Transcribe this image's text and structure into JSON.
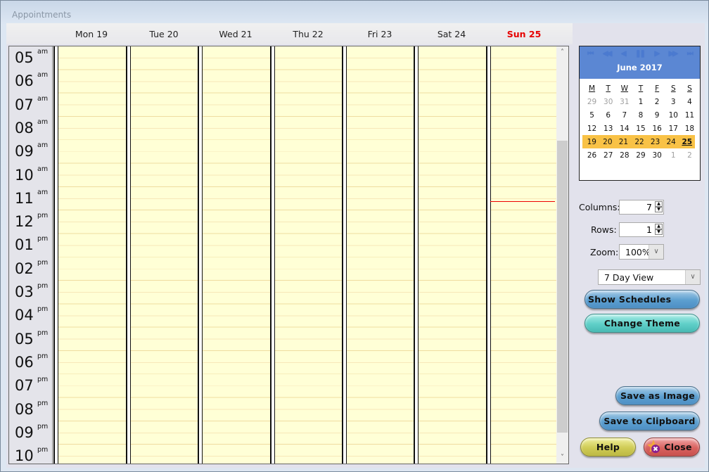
{
  "window": {
    "title": "Appointments"
  },
  "days": [
    {
      "label": "Mon 19",
      "today": false
    },
    {
      "label": "Tue 20",
      "today": false
    },
    {
      "label": "Wed 21",
      "today": false
    },
    {
      "label": "Thu 22",
      "today": false
    },
    {
      "label": "Fri 23",
      "today": false
    },
    {
      "label": "Sat 24",
      "today": false
    },
    {
      "label": "Sun 25",
      "today": true
    }
  ],
  "hours": [
    {
      "hr": "05",
      "ap": "am"
    },
    {
      "hr": "06",
      "ap": "am"
    },
    {
      "hr": "07",
      "ap": "am"
    },
    {
      "hr": "08",
      "ap": "am"
    },
    {
      "hr": "09",
      "ap": "am"
    },
    {
      "hr": "10",
      "ap": "am"
    },
    {
      "hr": "11",
      "ap": "am"
    },
    {
      "hr": "12",
      "ap": "pm"
    },
    {
      "hr": "01",
      "ap": "pm"
    },
    {
      "hr": "02",
      "ap": "pm"
    },
    {
      "hr": "03",
      "ap": "pm"
    },
    {
      "hr": "04",
      "ap": "pm"
    },
    {
      "hr": "05",
      "ap": "pm"
    },
    {
      "hr": "06",
      "ap": "pm"
    },
    {
      "hr": "07",
      "ap": "pm"
    },
    {
      "hr": "08",
      "ap": "pm"
    },
    {
      "hr": "09",
      "ap": "pm"
    },
    {
      "hr": "10",
      "ap": "pm"
    }
  ],
  "current_time_marker": {
    "day_index": 6,
    "hour_offset": 6.6
  },
  "scroll": {
    "up_icon": "^",
    "down_icon": "v"
  },
  "minical": {
    "month": "June 2017",
    "nav": [
      "first",
      "prev-year",
      "prev",
      "pause",
      "next",
      "next-year",
      "last"
    ],
    "dow": [
      "M",
      "T",
      "W",
      "T",
      "F",
      "S",
      "S"
    ],
    "weeks": [
      [
        [
          "29",
          1
        ],
        [
          "30",
          1
        ],
        [
          "31",
          1
        ],
        [
          "1",
          0
        ],
        [
          "2",
          0
        ],
        [
          "3",
          0
        ],
        [
          "4",
          0
        ]
      ],
      [
        [
          "5",
          0
        ],
        [
          "6",
          0
        ],
        [
          "7",
          0
        ],
        [
          "8",
          0
        ],
        [
          "9",
          0
        ],
        [
          "10",
          0
        ],
        [
          "11",
          0
        ]
      ],
      [
        [
          "12",
          0
        ],
        [
          "13",
          0
        ],
        [
          "14",
          0
        ],
        [
          "15",
          0
        ],
        [
          "16",
          0
        ],
        [
          "17",
          0
        ],
        [
          "18",
          0
        ]
      ],
      [
        [
          "19",
          0
        ],
        [
          "20",
          0
        ],
        [
          "21",
          0
        ],
        [
          "22",
          0
        ],
        [
          "23",
          0
        ],
        [
          "24",
          0
        ],
        [
          "25",
          2
        ]
      ],
      [
        [
          "26",
          0
        ],
        [
          "27",
          0
        ],
        [
          "28",
          0
        ],
        [
          "29",
          0
        ],
        [
          "30",
          0
        ],
        [
          "1",
          1
        ],
        [
          "2",
          1
        ]
      ]
    ],
    "selected_week": 3,
    "highlight_color": "#f9c246"
  },
  "controls": {
    "columns_label": "Columns:",
    "columns_value": "7",
    "rows_label": "Rows:",
    "rows_value": "1",
    "zoom_label": "Zoom:",
    "zoom_value": "100%",
    "view_value": "7 Day View"
  },
  "buttons": {
    "show_schedules": "Show Schedules",
    "change_theme": "Change Theme",
    "save_image": "Save as Image",
    "save_clipboard": "Save to Clipboard",
    "help": "Help",
    "close": "Close"
  }
}
